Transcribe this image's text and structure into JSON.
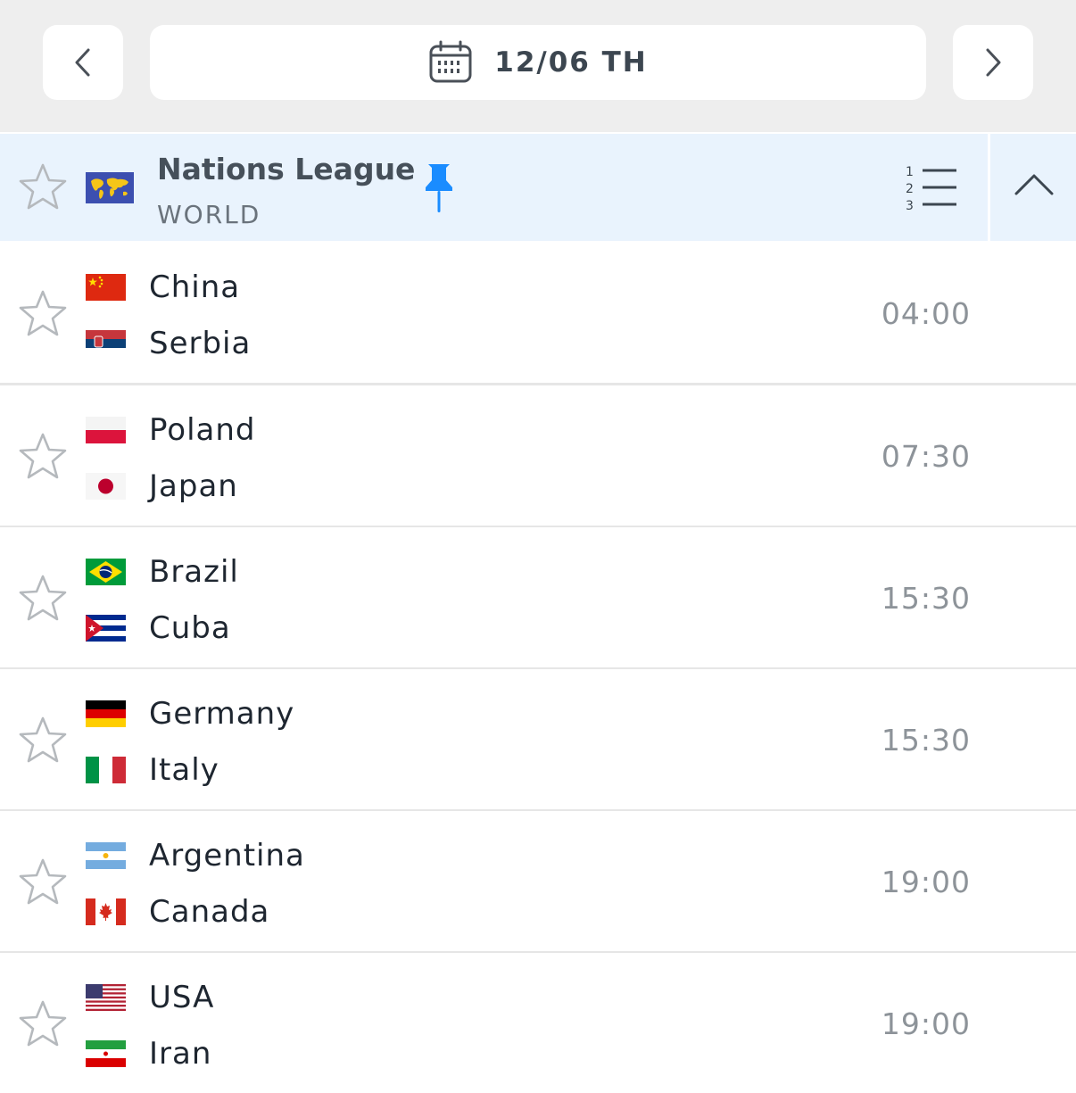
{
  "header": {
    "date_label": "12/06 TH",
    "prev_icon": "chevron-left-icon",
    "next_icon": "chevron-right-icon",
    "calendar_icon": "calendar-icon"
  },
  "league": {
    "name": "Nations League",
    "country": "WORLD",
    "pinned": true,
    "accent_color": "#1a8cff",
    "background_color": "#e9f3fd"
  },
  "matches": [
    {
      "home": "China",
      "away": "Serbia",
      "time": "04:00"
    },
    {
      "home": "Poland",
      "away": "Japan",
      "time": "07:30"
    },
    {
      "home": "Brazil",
      "away": "Cuba",
      "time": "15:30"
    },
    {
      "home": "Germany",
      "away": "Italy",
      "time": "15:30"
    },
    {
      "home": "Argentina",
      "away": "Canada",
      "time": "19:00"
    },
    {
      "home": "USA",
      "away": "Iran",
      "time": "19:00"
    }
  ]
}
